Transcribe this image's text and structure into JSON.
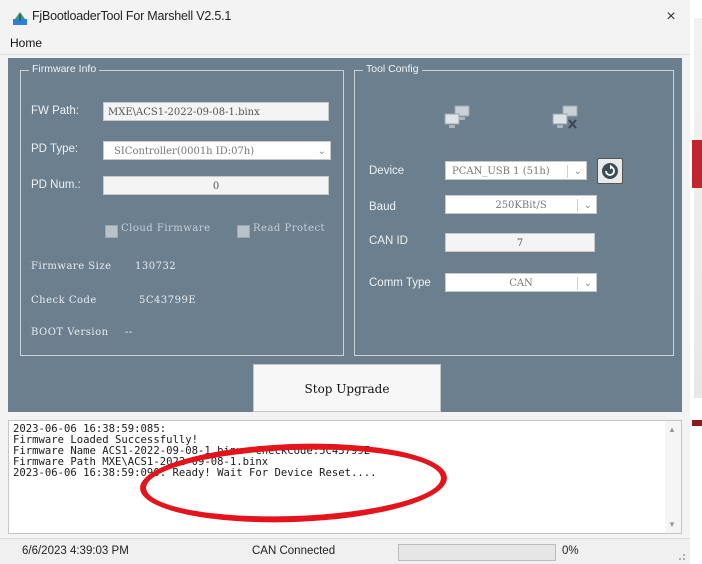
{
  "window": {
    "title": "FjBootloaderTool For Marshell V2.5.1",
    "close_glyph": "×"
  },
  "menu": {
    "home": "Home"
  },
  "firmware": {
    "legend": "Firmware Info",
    "fw_path_label": "FW Path:",
    "fw_path_value": "MXE\\ACS1-2022-09-08-1.binx",
    "pd_type_label": "PD Type:",
    "pd_type_value": "SIController(0001h ID:07h)",
    "pd_num_label": "PD Num.:",
    "pd_num_value": "0",
    "cloud_firmware_label": "Cloud Firmware",
    "read_protect_label": "Read Protect",
    "firmware_size_label": "Firmware Size",
    "firmware_size_value": "130732",
    "check_code_label": "Check Code",
    "check_code_value": "5C43799E",
    "boot_version_label": "BOOT Version",
    "boot_version_value": "--"
  },
  "tool_config": {
    "legend": "Tool Config",
    "device_label": "Device",
    "device_value": "PCAN_USB 1 (51h)",
    "baud_label": "Baud",
    "baud_value": "250KBit/S",
    "can_id_label": "CAN ID",
    "can_id_value": "7",
    "comm_type_label": "Comm Type",
    "comm_type_value": "CAN"
  },
  "actions": {
    "stop_upgrade": "Stop Upgrade"
  },
  "log": {
    "lines": [
      "2023-06-06 16:38:59:085:",
      "Firmware Loaded Successfully!",
      "Firmware Name ACS1-2022-09-08-1.binx  CheckCode:5C43799E",
      "Firmware Path MXE\\ACS1-2022-09-08-1.binx",
      "2023-06-06 16:38:59:090: Ready! Wait For Device Reset...."
    ]
  },
  "status": {
    "datetime": "6/6/2023 4:39:03 PM",
    "connection": "CAN Connected",
    "progress_percent": 0,
    "progress_text": "0%"
  },
  "colors": {
    "panel": "#6b7f8f",
    "annotation": "#e3141c",
    "progress_fill": "#06b025"
  }
}
